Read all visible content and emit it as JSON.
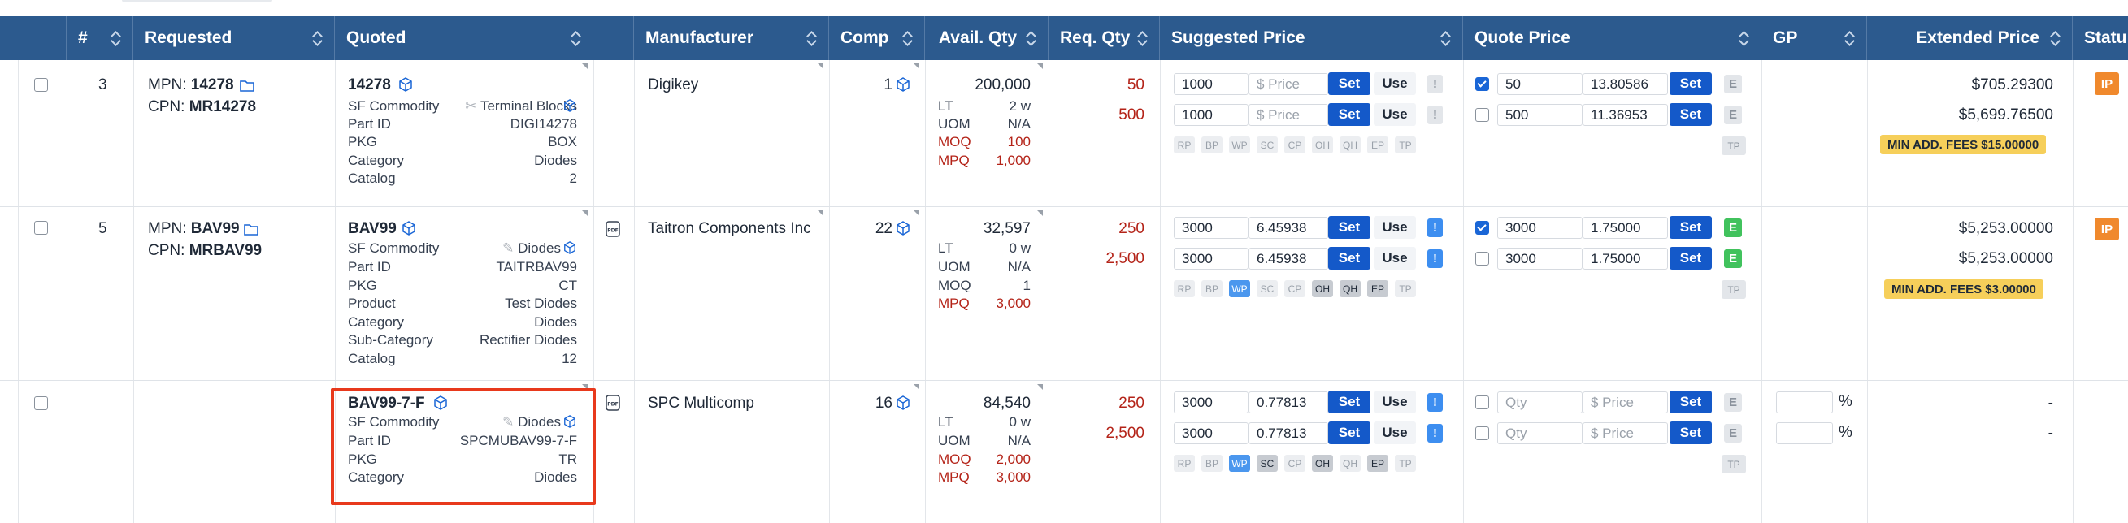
{
  "header": {
    "num": "#",
    "requested": "Requested",
    "quoted": "Quoted",
    "manufacturer": "Manufacturer",
    "comp": "Comp",
    "avail_qty": "Avail. Qty",
    "req_qty": "Req. Qty",
    "suggested_price": "Suggested Price",
    "quote_price": "Quote Price",
    "gp": "GP",
    "extended_price": "Extended Price",
    "status": "Statu"
  },
  "common": {
    "mpn_label": "MPN:",
    "cpn_label": "CPN:",
    "lt_label": "LT",
    "uom_label": "UOM",
    "moq_label": "MOQ",
    "mpq_label": "MPQ",
    "set_label": "Set",
    "use_label": "Use",
    "bang": "!",
    "price_placeholder": "$ Price",
    "qty_placeholder": "Qty",
    "pct": "%",
    "tags": [
      "RP",
      "BP",
      "WP",
      "SC",
      "CP",
      "OH",
      "QH",
      "EP",
      "TP"
    ],
    "e_label": "E",
    "tp_label": "TP",
    "ip_label": "IP",
    "dash": "-"
  },
  "rows": [
    {
      "num": "3",
      "mpn": "14278",
      "cpn": "MR14278",
      "quoted_title": "14278",
      "details": [
        {
          "label": "SF Commodity",
          "value": "Terminal Blocks"
        },
        {
          "label": "Part ID",
          "value": "DIGI14278"
        },
        {
          "label": "PKG",
          "value": "BOX"
        },
        {
          "label": "Category",
          "value": "Diodes"
        },
        {
          "label": "Catalog",
          "value": "2"
        }
      ],
      "manufacturer": "Digikey",
      "comp": "1",
      "avail": "200,000",
      "lt": "2 w",
      "uom": "N/A",
      "moq": "100",
      "mpq": "1,000",
      "req1": "50",
      "req2": "500",
      "sug": [
        {
          "qty": "1000",
          "price": ""
        },
        {
          "qty": "1000",
          "price": ""
        }
      ],
      "quote": [
        {
          "qty": "50",
          "price": "13.80586",
          "checked": true
        },
        {
          "qty": "500",
          "price": "11.36953",
          "checked": false
        }
      ],
      "ext1": "$705.29300",
      "ext2": "$5,699.76500",
      "fee": "MIN ADD. FEES $15.00000"
    },
    {
      "num": "5",
      "mpn": "BAV99",
      "cpn": "MRBAV99",
      "quoted_title": "BAV99",
      "details": [
        {
          "label": "SF Commodity",
          "value": "Diodes"
        },
        {
          "label": "Part ID",
          "value": "TAITRBAV99"
        },
        {
          "label": "PKG",
          "value": "CT"
        },
        {
          "label": "Product",
          "value": "Test Diodes"
        },
        {
          "label": "Category",
          "value": "Diodes"
        },
        {
          "label": "Sub-Category",
          "value": "Rectifier Diodes"
        },
        {
          "label": "Catalog",
          "value": "12"
        }
      ],
      "manufacturer": "Taitron Components Inc",
      "comp": "22",
      "avail": "32,597",
      "lt": "0 w",
      "uom": "N/A",
      "moq": "1",
      "mpq": "3,000",
      "req1": "250",
      "req2": "2,500",
      "sug": [
        {
          "qty": "3000",
          "price": "6.45938"
        },
        {
          "qty": "3000",
          "price": "6.45938"
        }
      ],
      "quote": [
        {
          "qty": "3000",
          "price": "1.75000",
          "checked": true
        },
        {
          "qty": "3000",
          "price": "1.75000",
          "checked": false
        }
      ],
      "ext1": "$5,253.00000",
      "ext2": "$5,253.00000",
      "fee": "MIN ADD. FEES $3.00000"
    },
    {
      "num": "",
      "mpn": "",
      "cpn": "",
      "quoted_title": "BAV99-7-F",
      "details": [
        {
          "label": "SF Commodity",
          "value": "Diodes"
        },
        {
          "label": "Part ID",
          "value": "SPCMUBAV99-7-F"
        },
        {
          "label": "PKG",
          "value": "TR"
        },
        {
          "label": "Category",
          "value": "Diodes"
        }
      ],
      "manufacturer": "SPC Multicomp",
      "comp": "16",
      "avail": "84,540",
      "lt": "0 w",
      "uom": "N/A",
      "moq": "2,000",
      "mpq": "3,000",
      "req1": "250",
      "req2": "2,500",
      "sug": [
        {
          "qty": "3000",
          "price": "0.77813"
        },
        {
          "qty": "3000",
          "price": "0.77813"
        }
      ],
      "quote": [
        {
          "qty": "",
          "price": "",
          "checked": false
        },
        {
          "qty": "",
          "price": "",
          "checked": false
        }
      ],
      "ext1": "-",
      "ext2": "-",
      "fee": ""
    }
  ]
}
